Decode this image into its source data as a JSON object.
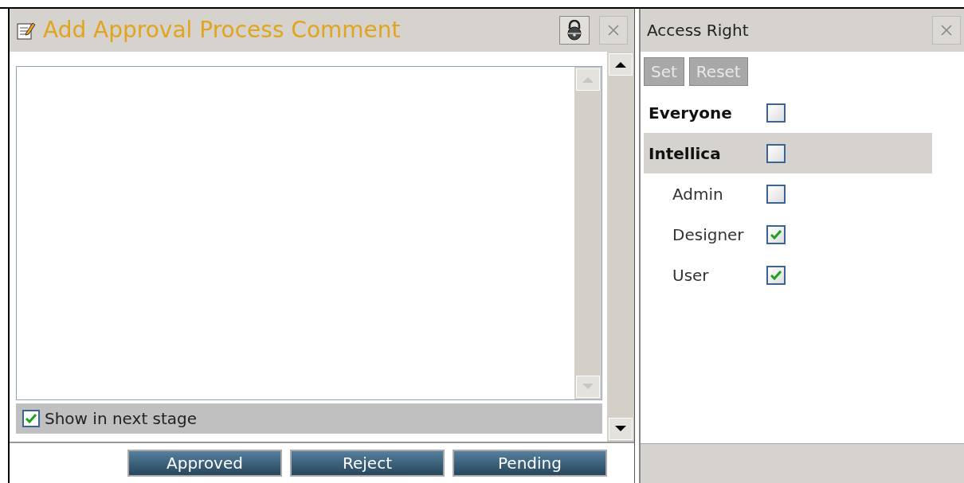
{
  "comment_dialog": {
    "title": "Add Approval Process Comment",
    "show_in_next_stage": {
      "label": "Show in next stage",
      "checked": true
    },
    "buttons": [
      "Approved",
      "Reject",
      "Pending"
    ]
  },
  "access_panel": {
    "title": "Access Right",
    "buttons": [
      {
        "label": "Set",
        "disabled": true
      },
      {
        "label": "Reset",
        "disabled": true
      }
    ],
    "tree": [
      {
        "label": "Everyone",
        "checked": false,
        "selected": false
      },
      {
        "label": "Intellica",
        "checked": false,
        "selected": true,
        "children": [
          {
            "label": "Admin",
            "checked": false,
            "selected": false
          },
          {
            "label": "Designer",
            "checked": true,
            "selected": false
          },
          {
            "label": "User",
            "checked": true,
            "selected": false
          }
        ]
      }
    ]
  }
}
